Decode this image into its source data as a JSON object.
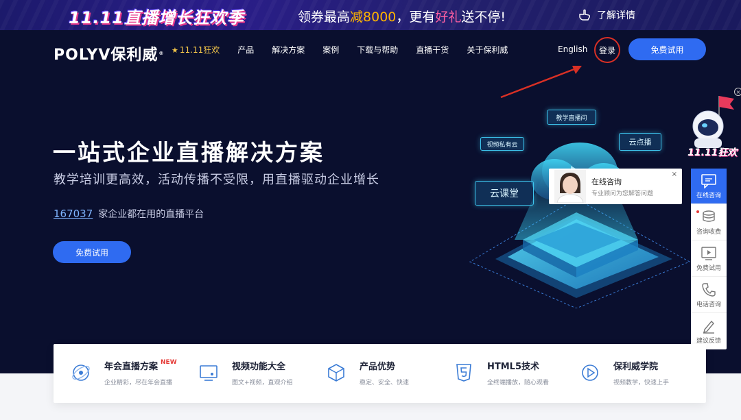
{
  "promo": {
    "title": "11.11直播增长狂欢季",
    "msg_prefix": "领券最高",
    "msg_hl": "减8000",
    "msg_mid": "，更有",
    "msg_hl2": "好礼",
    "msg_suffix": "送不停!",
    "detail": "了解详情"
  },
  "header": {
    "logo": "POLYV保利威",
    "logo_reg": "®",
    "promo_nav": "11.11狂欢",
    "nav": [
      "产品",
      "解决方案",
      "案例",
      "下载与帮助",
      "直播干货",
      "关于保利威"
    ],
    "lang": "English",
    "login": "登录",
    "trial": "免费试用"
  },
  "hero": {
    "title": "一站式企业直播解决方案",
    "subtitle": "教学培训更高效，活动传播不受限，用直播驱动企业增长",
    "stat_num": "167037",
    "stat_text": "家企业都在用的直播平台",
    "button": "免费试用"
  },
  "illustration": {
    "tags": [
      "教学直播间",
      "视频私有云",
      "云点播",
      "云课堂"
    ]
  },
  "consult": {
    "title": "在线咨询",
    "desc": "专业顾问为您解答问题",
    "close": "×"
  },
  "mascot": {
    "text": "11.11狂欢",
    "close": "×"
  },
  "sidebar": {
    "items": [
      "在线咨询",
      "咨询收费",
      "免费试用",
      "电话咨询",
      "建议反馈"
    ]
  },
  "features": [
    {
      "title": "年会直播方案",
      "badge": "NEW",
      "desc": "企业精彩，尽在年会直播"
    },
    {
      "title": "视频功能大全",
      "badge": "",
      "desc": "图文+视频，直观介绍"
    },
    {
      "title": "产品优势",
      "badge": "",
      "desc": "稳定、安全、快速"
    },
    {
      "title": "HTML5技术",
      "badge": "",
      "desc": "全终端播放，随心观看"
    },
    {
      "title": "保利威学院",
      "badge": "",
      "desc": "视频教学，快速上手"
    }
  ],
  "colors": {
    "accent": "#2f6bf1",
    "bg": "#0a0f2e",
    "highlight_ring": "#d93025",
    "promo_gold": "#ffb400"
  }
}
